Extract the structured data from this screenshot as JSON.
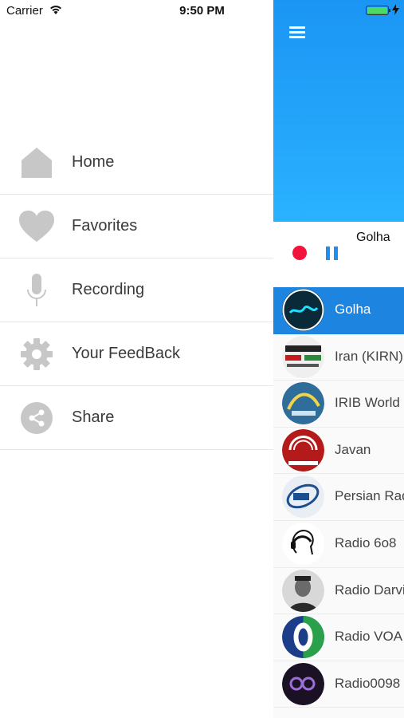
{
  "status_bar": {
    "carrier": "Carrier",
    "time": "9:50 PM"
  },
  "menu": {
    "items": [
      {
        "label": "Home",
        "icon": "home-icon"
      },
      {
        "label": "Favorites",
        "icon": "heart-icon"
      },
      {
        "label": "Recording",
        "icon": "microphone-icon"
      },
      {
        "label": "Your FeedBack",
        "icon": "gear-icon"
      },
      {
        "label": "Share",
        "icon": "share-icon"
      }
    ]
  },
  "colors": {
    "accent": "#1d84e0",
    "header": "#1b95f4",
    "record": "#f2123c",
    "icon_gray": "#c7c7c7"
  },
  "player": {
    "title": "Golha"
  },
  "stations": [
    {
      "name": "Golha",
      "active": true
    },
    {
      "name": "Iran (KIRN)"
    },
    {
      "name": "IRIB World S"
    },
    {
      "name": "Javan"
    },
    {
      "name": "Persian Rad"
    },
    {
      "name": "Radio 6o8"
    },
    {
      "name": "Radio Darvi"
    },
    {
      "name": "Radio VOA"
    },
    {
      "name": "Radio0098"
    }
  ]
}
